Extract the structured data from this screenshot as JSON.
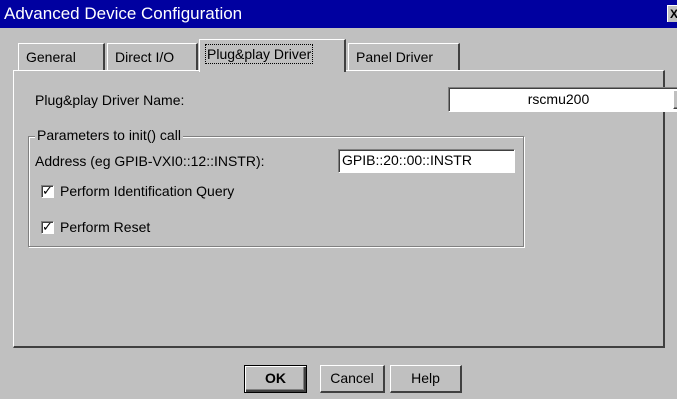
{
  "window": {
    "title": "Advanced Device Configuration",
    "close_glyph": "X"
  },
  "tabs": [
    {
      "label": "General",
      "active": false
    },
    {
      "label": "Direct I/O",
      "active": false
    },
    {
      "label": "Plug&play Driver",
      "active": true
    },
    {
      "label": "Panel Driver",
      "active": false
    }
  ],
  "driver": {
    "name_label": "Plug&play Driver Name:",
    "selected_value": "rscmu200"
  },
  "init_params": {
    "group_label": "Parameters to init() call",
    "address_label": "Address (eg GPIB-VXI0::12::INSTR):",
    "address_value": "GPIB::20::00::INSTR",
    "id_query_label": "Perform Identification Query",
    "id_query_checked": true,
    "reset_label": "Perform Reset",
    "reset_checked": true
  },
  "buttons": {
    "ok": "OK",
    "cancel": "Cancel",
    "help": "Help"
  },
  "colors": {
    "titlebar": "#0000a0",
    "face": "#c0c0c0"
  }
}
